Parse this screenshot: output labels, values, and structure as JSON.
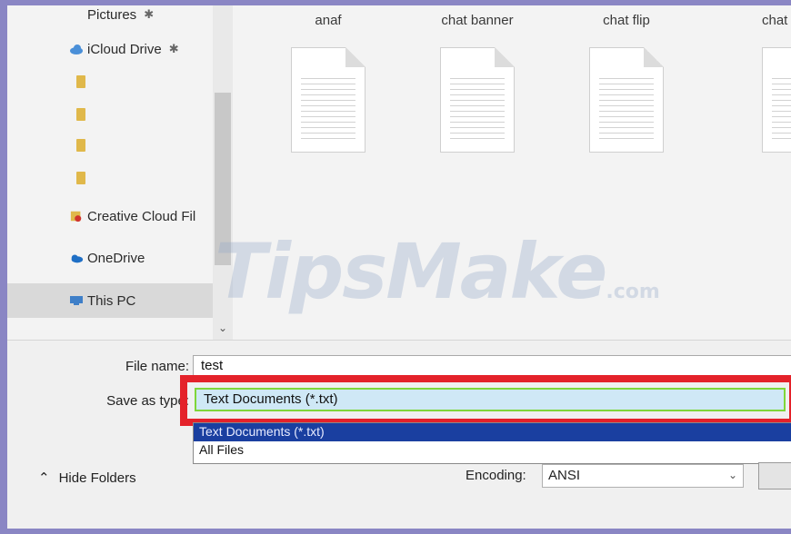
{
  "sidebar": {
    "items": [
      {
        "label": "Pictures",
        "icon": "pictures-icon"
      },
      {
        "label": "iCloud Drive",
        "icon": "cloud-icon",
        "pinned": true
      },
      {
        "label": "",
        "icon": "folder-icon"
      },
      {
        "label": "",
        "icon": "folder-icon"
      },
      {
        "label": "",
        "icon": "folder-icon"
      },
      {
        "label": "",
        "icon": "folder-icon"
      },
      {
        "label": "Creative Cloud Fil",
        "icon": "creative-cloud-icon"
      },
      {
        "label": "OneDrive",
        "icon": "onedrive-icon"
      },
      {
        "label": "This PC",
        "icon": "computer-icon",
        "selected": true
      }
    ],
    "pin_glyph": "✱"
  },
  "files": [
    "anaf",
    "chat banner",
    "chat flip",
    "chat"
  ],
  "watermark": {
    "main": "TipsMake",
    "suffix": ".com"
  },
  "form": {
    "filename_label": "File name:",
    "filename_value": "test",
    "savetype_label": "Save as type:",
    "savetype_value": "Text Documents (*.txt)",
    "options": [
      "Text Documents (*.txt)",
      "All Files"
    ],
    "selected_option": 0,
    "hide_folders_label": "Hide Folders",
    "encoding_label": "Encoding:",
    "encoding_value": "ANSI"
  },
  "colors": {
    "highlight": "#e4222a",
    "selection": "#1a3fa0",
    "border_frame": "#8a86c4"
  }
}
